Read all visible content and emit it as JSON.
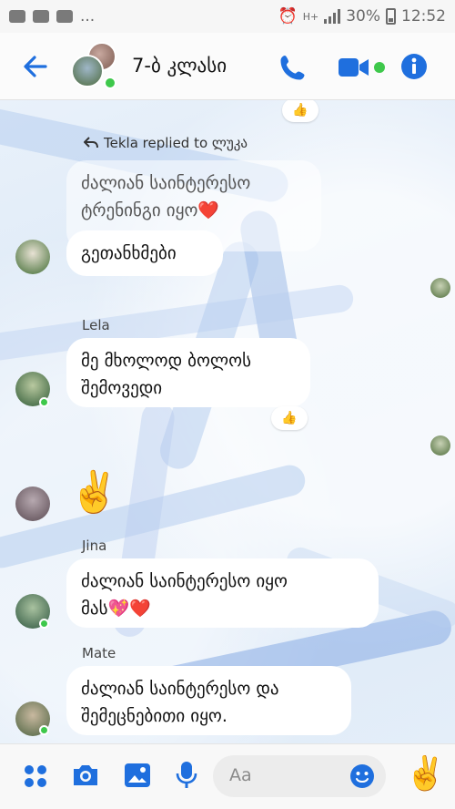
{
  "status_bar": {
    "dots": "...",
    "battery": "30%",
    "time": "12:52",
    "network": "H+"
  },
  "header": {
    "title": "7-ბ კლასი"
  },
  "messages": {
    "reply_context": "Tekla replied to ლუკა",
    "quoted_text_line1": "ძალიან საინტერესო",
    "quoted_text_line2": "ტრენინგი იყო❤️",
    "tekla_reply": "გეთანხმები",
    "lela_name": "Lela",
    "lela_line1": "მე მხოლოდ ბოლოს",
    "lela_line2": "შემოვედი",
    "victory_emoji": "✌️",
    "jina_name": "Jina",
    "jina_line1": "ძალიან საინტერესო იყო",
    "jina_line2": "მას💖❤️",
    "mate_name": "Mate",
    "mate_line1": "ძალიან საინტერესო და",
    "mate_line2": "შემეცნებითი იყო.",
    "thumbs_reaction": "👍"
  },
  "composer": {
    "placeholder": "Aa",
    "quick_emoji": "✌️"
  },
  "colors": {
    "accent": "#1f6fde",
    "online": "#3ec84b"
  }
}
